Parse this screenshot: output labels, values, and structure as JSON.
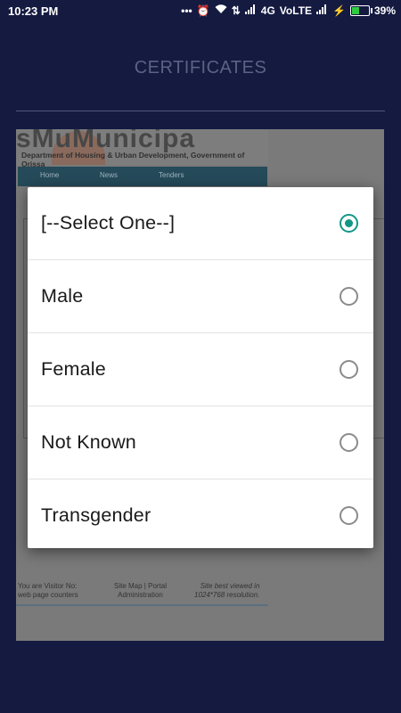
{
  "status_bar": {
    "time": "10:23 PM",
    "network_4g": "4G",
    "volte": "VoLTE",
    "battery_percent": "39%",
    "battery_level": 0.39,
    "icons": [
      "more-dots-icon",
      "alarm-icon",
      "wifi-icon",
      "data-arrows-icon",
      "signal-icon",
      "signal-icon",
      "charging-icon",
      "battery-icon"
    ]
  },
  "app": {
    "title": "CERTIFICATES"
  },
  "webpage": {
    "banner": "sMuMunicipa",
    "department": "Department of Housing & Urban Development, Government of Orissa",
    "nav": [
      "Home",
      "News",
      "Tenders"
    ],
    "footer": {
      "visitor": "You are Visitor No:",
      "counter": "web page counters",
      "site_map": "Site Map",
      "portal": "Portal",
      "administration": "Administration",
      "best_viewed": "Site best viewed in",
      "resolution": "1024*768 resolution."
    }
  },
  "dialog": {
    "options": [
      {
        "label": "[--Select One--]",
        "selected": true
      },
      {
        "label": "Male",
        "selected": false
      },
      {
        "label": "Female",
        "selected": false
      },
      {
        "label": "Not Known",
        "selected": false
      },
      {
        "label": "Transgender",
        "selected": false
      }
    ]
  },
  "colors": {
    "background": "#141a40",
    "accent": "#129688",
    "dialog": "#ffffff"
  }
}
